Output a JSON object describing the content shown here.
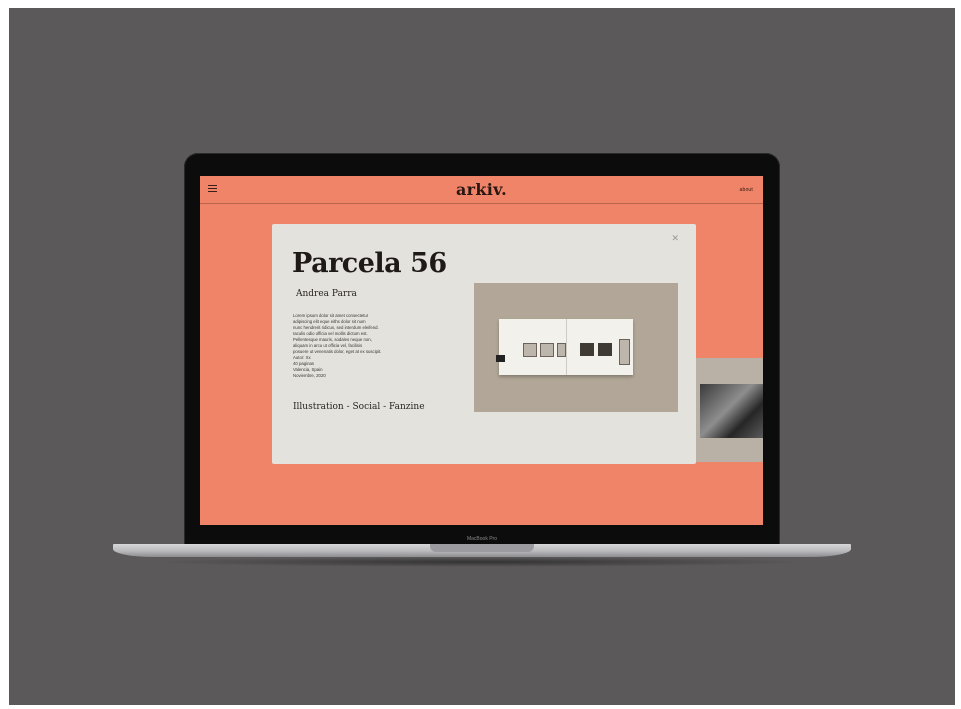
{
  "site": {
    "logo": "arkiv.",
    "about_label": "about",
    "menu_icon": "hamburger-menu-icon"
  },
  "project": {
    "title": "Parcela 56",
    "author": "Andrea Parra",
    "body_lines": [
      "Lorem ipsum dolor sit amet consectetur",
      "adipiscing elit eque eiths dolor sit num",
      "nunc hendrerit ridicus, sed interdum eleifend.",
      "Iaculis odio officia vel mollis dictum est.",
      "Pellentesque mauris, sodales neque non,",
      "aliquam in arcu ut officia vel, facilisis",
      "posuere ut venenatis dolor, eget at ex suscipit.",
      "Autor: Xx",
      "40 paginas",
      "Valencia, Spain",
      "Noviembre, 2020"
    ],
    "tags": "Illustration - Social - Fanzine",
    "close_icon": "close-icon"
  },
  "device": {
    "label": "MacBook Pro"
  }
}
